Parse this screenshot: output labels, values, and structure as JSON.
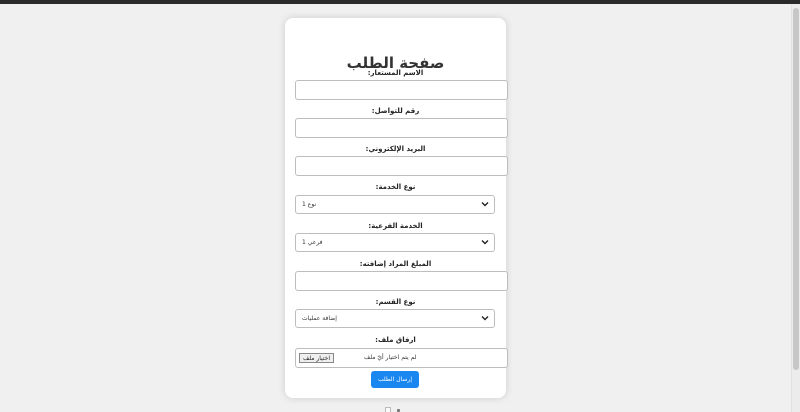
{
  "form": {
    "title": "صفحة الطلب",
    "fields": [
      {
        "label": ":الاسم المستعار",
        "value": ""
      },
      {
        "label": ":رقم للتواصل",
        "value": ""
      },
      {
        "label": ":البريد الإلكتروني",
        "value": ""
      }
    ],
    "service_type": {
      "label": ":نوع الخدمة",
      "selected": "نوع 1"
    },
    "sub_service": {
      "label": ":الخدمة الفرعية",
      "selected": "فرعي 1"
    },
    "amount": {
      "label": ":المبلغ المراد إضافته",
      "value": ""
    },
    "section_type": {
      "label": ":نوع القسم",
      "selected": "إضافة عمليات"
    },
    "attachment": {
      "label": ":ارفاق ملف",
      "button": "اختيار ملف",
      "status": "لم يتم اختيار أيّ ملف"
    },
    "submit_label": "إرسال الطلب"
  },
  "icons": {
    "select_arrow": "chevron-down-icon",
    "footer": "broken-image-icon"
  },
  "colors": {
    "primary": "#1a86f0",
    "background": "#f0f0f0",
    "card": "#ffffff"
  }
}
